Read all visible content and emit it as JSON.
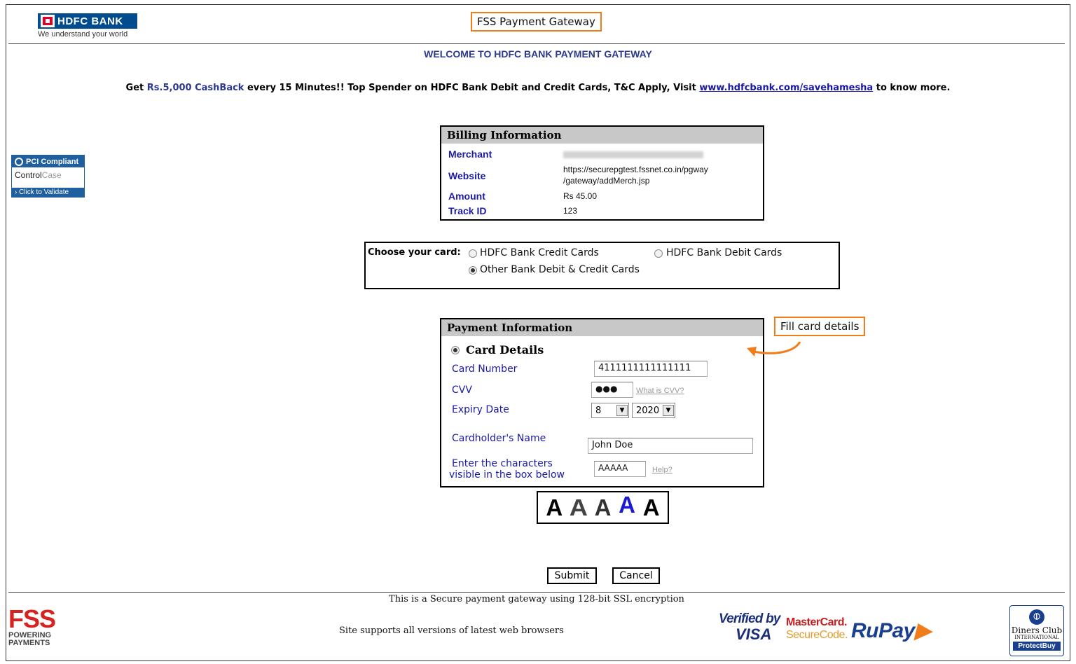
{
  "header": {
    "logo_name": "HDFC BANK",
    "logo_tagline": "We understand your world",
    "gateway_annotation": "FSS Payment Gateway"
  },
  "welcome": "WELCOME TO HDFC BANK PAYMENT GATEWAY",
  "promo": {
    "prefix": "Get ",
    "highlight": "Rs.5,000 CashBack",
    "middle": " every 15 Minutes!! Top Spender on HDFC Bank Debit and Credit Cards, T&C Apply, Visit ",
    "link": "www.hdfcbank.com/savehamesha",
    "suffix": " to know more."
  },
  "pci_badge": {
    "top": "PCI Compliant",
    "mid_left": "Control",
    "mid_right": "Case",
    "bottom": "› Click to Validate"
  },
  "billing": {
    "title": "Billing Information",
    "merchant_label": "Merchant",
    "website_label": "Website",
    "website_value_line1": "https://securepgtest.fssnet.co.in/pgway",
    "website_value_line2": "/gateway/addMerch.jsp",
    "amount_label": "Amount",
    "amount_value": "Rs 45.00",
    "track_label": "Track ID",
    "track_value": "123"
  },
  "choose_card": {
    "label": "Choose your card:",
    "options": [
      {
        "label": "HDFC Bank Credit Cards",
        "selected": false
      },
      {
        "label": "HDFC Bank Debit Cards",
        "selected": false
      },
      {
        "label": "Other Bank Debit & Credit Cards",
        "selected": true
      }
    ]
  },
  "payment": {
    "title": "Payment Information",
    "card_details_label": "Card Details",
    "card_number_label": "Card Number",
    "card_number_value": "4111111111111111",
    "cvv_label": "CVV",
    "cvv_value": "●●●",
    "cvv_help": "What is CVV?",
    "expiry_label": "Expiry Date",
    "expiry_month": "8",
    "expiry_year": "2020",
    "name_label": "Cardholder's Name",
    "name_value": "John Doe",
    "captcha_label_line1": "Enter the characters",
    "captcha_label_line2": "visible in the box below",
    "captcha_value": "AAAAA",
    "captcha_help": "Help?"
  },
  "annotation_fill": "Fill card details",
  "captcha_image": [
    "A",
    "A",
    "A",
    "A",
    "A"
  ],
  "buttons": {
    "submit": "Submit",
    "cancel": "Cancel"
  },
  "footer": {
    "secure_text": "This is a Secure payment gateway using 128-bit SSL encryption",
    "browser_text": "Site supports all versions of latest web browsers",
    "fss_big": "FSS",
    "fss_small_1": "POWERING",
    "fss_small_2": "PAYMENTS",
    "vbv_1": "Verified by",
    "vbv_2": "VISA",
    "msc_1": "MasterCard.",
    "msc_2": "SecureCode.",
    "rupay": "RuPay",
    "diners_name": "Diners Club",
    "diners_intl": "INTERNATIONAL",
    "diners_pb": "ProtectBuy"
  },
  "colors": {
    "brand_blue": "#004c8f",
    "link_blue": "#1a1aa6",
    "annotation_orange": "#f07d1a"
  }
}
